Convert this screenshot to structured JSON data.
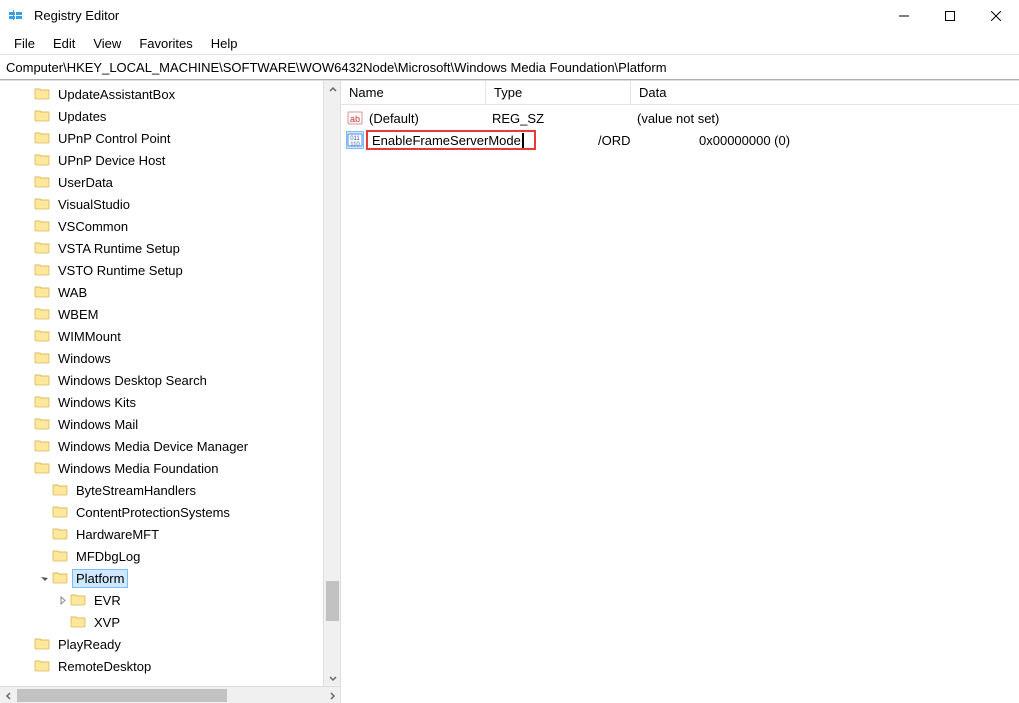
{
  "window": {
    "title": "Registry Editor"
  },
  "menu": {
    "file": "File",
    "edit": "Edit",
    "view": "View",
    "favorites": "Favorites",
    "help": "Help"
  },
  "address": "Computer\\HKEY_LOCAL_MACHINE\\SOFTWARE\\WOW6432Node\\Microsoft\\Windows Media Foundation\\Platform",
  "tree": {
    "items": [
      {
        "label": "UpdateAssistantBox",
        "indent": 1
      },
      {
        "label": "Updates",
        "indent": 1
      },
      {
        "label": "UPnP Control Point",
        "indent": 1
      },
      {
        "label": "UPnP Device Host",
        "indent": 1
      },
      {
        "label": "UserData",
        "indent": 1
      },
      {
        "label": "VisualStudio",
        "indent": 1
      },
      {
        "label": "VSCommon",
        "indent": 1
      },
      {
        "label": "VSTA Runtime Setup",
        "indent": 1
      },
      {
        "label": "VSTO Runtime Setup",
        "indent": 1
      },
      {
        "label": "WAB",
        "indent": 1
      },
      {
        "label": "WBEM",
        "indent": 1
      },
      {
        "label": "WIMMount",
        "indent": 1
      },
      {
        "label": "Windows",
        "indent": 1
      },
      {
        "label": "Windows Desktop Search",
        "indent": 1
      },
      {
        "label": "Windows Kits",
        "indent": 1
      },
      {
        "label": "Windows Mail",
        "indent": 1
      },
      {
        "label": "Windows Media Device Manager",
        "indent": 1
      },
      {
        "label": "Windows Media Foundation",
        "indent": 1
      },
      {
        "label": "ByteStreamHandlers",
        "indent": 2
      },
      {
        "label": "ContentProtectionSystems",
        "indent": 2
      },
      {
        "label": "HardwareMFT",
        "indent": 2
      },
      {
        "label": "MFDbgLog",
        "indent": 2
      },
      {
        "label": "Platform",
        "indent": 2,
        "selected": true,
        "exp": "open"
      },
      {
        "label": "EVR",
        "indent": 3,
        "exp": "closed"
      },
      {
        "label": "XVP",
        "indent": 3
      },
      {
        "label": "PlayReady",
        "indent": 1
      },
      {
        "label": "RemoteDesktop",
        "indent": 1
      }
    ]
  },
  "columns": {
    "name": "Name",
    "type": "Type",
    "data": "Data"
  },
  "values": {
    "rows": [
      {
        "name": "(Default)",
        "type": "REG_SZ",
        "data": "(value not set)",
        "iconKind": "string"
      },
      {
        "name": "EnableFrameServerMode",
        "type_visible": "/ORD",
        "data": "0x00000000 (0)",
        "iconKind": "binary",
        "editing": true,
        "selected": true
      }
    ]
  }
}
